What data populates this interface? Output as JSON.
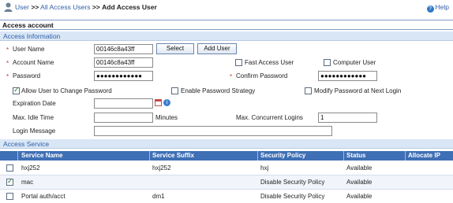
{
  "breadcrumb": {
    "items": [
      "User",
      "All Access Users",
      "Add Access User"
    ],
    "separator": ">>"
  },
  "help_label": "Help",
  "panel_title": "Access account",
  "sections": {
    "info": "Access Information",
    "service": "Access Service"
  },
  "form": {
    "user_name": {
      "label": "User Name",
      "value": "00146c8a43ff"
    },
    "select_button": "Select",
    "add_user_button": "Add User",
    "account_name": {
      "label": "Account Name",
      "value": "00146c8a43ff"
    },
    "fast_access_user": {
      "label": "Fast Access User",
      "checked": false
    },
    "computer_user": {
      "label": "Computer User",
      "checked": false
    },
    "password": {
      "label": "Password",
      "value": "●●●●●●●●●●●●"
    },
    "confirm_password": {
      "label": "Confirm Password",
      "value": "●●●●●●●●●●●●"
    },
    "allow_change_password": {
      "label": "Allow User to Change Password",
      "checked": true
    },
    "enable_password_strategy": {
      "label": "Enable Password Strategy",
      "checked": false
    },
    "modify_password_next_login": {
      "label": "Modify Password at Next Login",
      "checked": false
    },
    "expiration_date": {
      "label": "Expiration Date",
      "value": ""
    },
    "max_idle_time": {
      "label": "Max. Idle Time",
      "value": "",
      "unit": "Minutes"
    },
    "max_concurrent_logins": {
      "label": "Max. Concurrent Logins",
      "value": "1"
    },
    "login_message": {
      "label": "Login Message",
      "value": ""
    }
  },
  "service_table": {
    "columns": [
      "Service Name",
      "Service Suffix",
      "Security Policy",
      "Status",
      "Allocate IP"
    ],
    "rows": [
      {
        "checked": false,
        "name": "hxj252",
        "suffix": "hxj252",
        "policy": "hxj",
        "status": "Available",
        "allocate_ip": ""
      },
      {
        "checked": true,
        "name": "mac",
        "suffix": "",
        "policy": "Disable Security Policy",
        "status": "Available",
        "allocate_ip": ""
      },
      {
        "checked": false,
        "name": "Portal auth/acct",
        "suffix": "dm1",
        "policy": "Disable Security Policy",
        "status": "Available",
        "allocate_ip": ""
      }
    ]
  },
  "colors": {
    "link": "#2f5fa8",
    "section_bg": "#d9e6f5",
    "table_header": "#3f6fb5",
    "required": "#c0392b"
  }
}
